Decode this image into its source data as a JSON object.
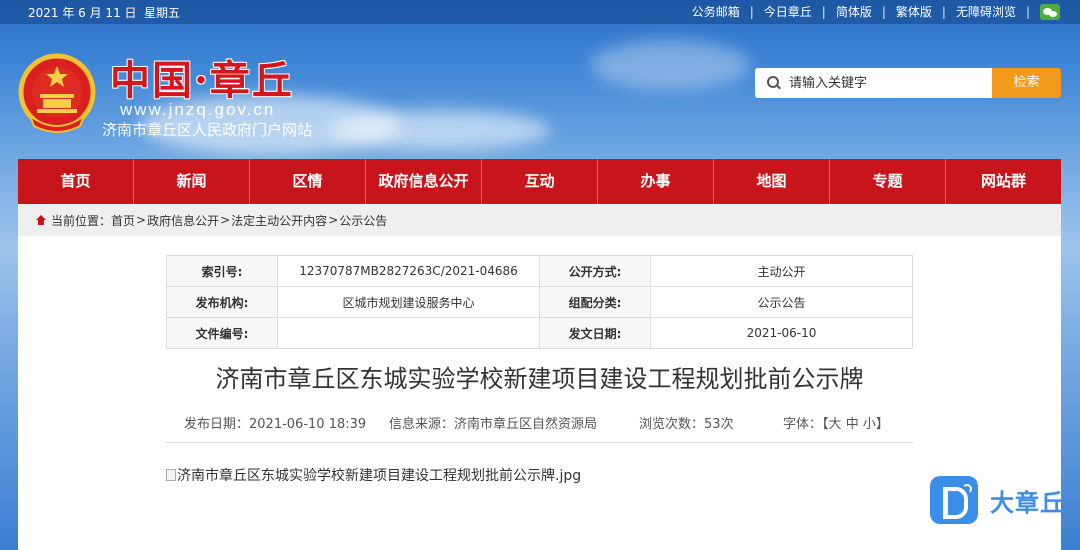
{
  "topbar": {
    "date": "2021 年 6 月 11 日",
    "weekday": "星期五",
    "links": [
      "公务邮箱",
      "今日章丘",
      "简体版",
      "繁体版",
      "无障碍浏览"
    ],
    "wechat_icon": "wechat-icon"
  },
  "header": {
    "logo_text": "中国·章丘",
    "url": "www.jnzq.gov.cn",
    "subtitle": "济南市章丘区人民政府门户网站",
    "emblem_icon": "national-emblem-icon"
  },
  "search": {
    "placeholder": "请输入关键字",
    "button_label": "检索"
  },
  "nav": [
    "首页",
    "新闻",
    "区情",
    "政府信息公开",
    "互动",
    "办事",
    "地图",
    "专题",
    "网站群"
  ],
  "breadcrumb": {
    "prefix": "当前位置：",
    "items": [
      "首页",
      "政府信息公开",
      "法定主动公开内容",
      "公示公告"
    ],
    "sep": ">"
  },
  "meta": {
    "index_label": "索引号:",
    "index_value": "12370787MB2827263C/2021-04686",
    "open_mode_label": "公开方式:",
    "open_mode_value": "主动公开",
    "publisher_label": "发布机构:",
    "publisher_value": "区城市规划建设服务中心",
    "category_label": "组配分类:",
    "category_value": "公示公告",
    "doc_no_label": "文件编号:",
    "doc_no_value": "",
    "issue_date_label": "发文日期:",
    "issue_date_value": "2021-06-10"
  },
  "article": {
    "title": "济南市章丘区东城实验学校新建项目建设工程规划批前公示牌",
    "publish_label": "发布日期：",
    "publish_value": "2021-06-10 18:39",
    "source_label": "信息来源：",
    "source_value": "济南市章丘区自然资源局",
    "views_label": "浏览次数：",
    "views_value": "53次",
    "font_label": "字体：",
    "font_open": "【",
    "font_sizes": [
      "大",
      "中",
      "小"
    ],
    "font_close": "】",
    "image_alt": "济南市章丘区东城实验学校新建项目建设工程规划批前公示牌.jpg"
  },
  "watermark": {
    "badge_icon": "dazhangqiu-logo-icon",
    "text": "大章丘"
  },
  "colors": {
    "nav_red": "#c8141b",
    "search_orange": "#f39a1c",
    "watermark_blue": "#3b8ee8"
  }
}
